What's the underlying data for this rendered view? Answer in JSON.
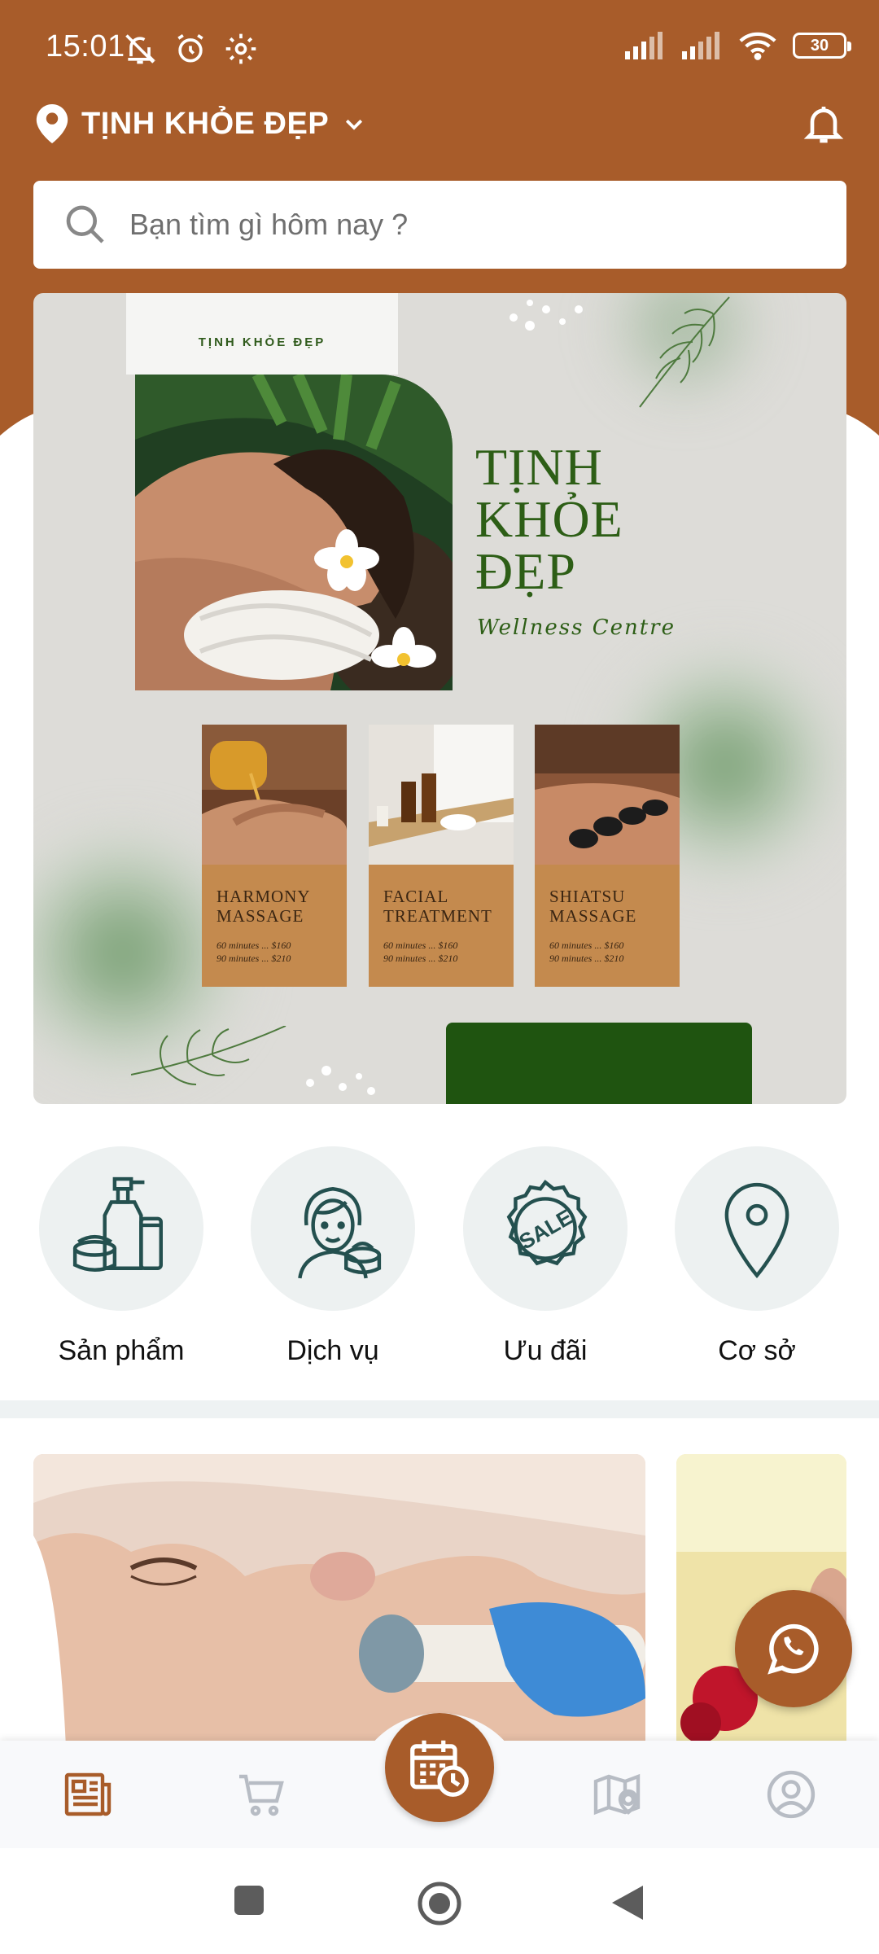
{
  "status_bar": {
    "time": "15:01",
    "battery": "30",
    "left_icons": [
      "notifications-off-icon",
      "alarm-icon",
      "settings-icon"
    ],
    "right_icons": [
      "signal-1-icon",
      "signal-2-icon",
      "wifi-icon",
      "battery-icon"
    ]
  },
  "header": {
    "location_name": "TỊNH KHỎE ĐẸP",
    "location_icon": "map-pin-icon",
    "dropdown_icon": "chevron-down-icon",
    "bell_icon": "bell-icon",
    "bg_color": "#a85c2a"
  },
  "search": {
    "placeholder": "Bạn tìm gì hôm nay ?"
  },
  "banner": {
    "tag": "TỊNH KHỎE ĐẸP",
    "title_lines": [
      "TỊNH",
      "KHỎE",
      "ĐẸP"
    ],
    "subtitle": "Wellness Centre",
    "cards": [
      {
        "title_1": "HARMONY",
        "title_2": "MASSAGE",
        "price_1": "60 minutes ... $160",
        "price_2": "90 minutes ... $210"
      },
      {
        "title_1": "FACIAL",
        "title_2": "TREATMENT",
        "price_1": "60 minutes ... $160",
        "price_2": "90 minutes ... $210"
      },
      {
        "title_1": "SHIATSU",
        "title_2": "MASSAGE",
        "price_1": "60 minutes ... $160",
        "price_2": "90 minutes ... $210"
      }
    ]
  },
  "categories": [
    {
      "label": "Sản phẩm",
      "icon": "cosmetics-icon"
    },
    {
      "label": "Dịch vụ",
      "icon": "facial-service-icon"
    },
    {
      "label": "Ưu đãi",
      "icon": "sale-badge-icon"
    },
    {
      "label": "Cơ sở",
      "icon": "location-pin-icon"
    }
  ],
  "fab": {
    "icon": "whatsapp-icon"
  },
  "bottom_nav": {
    "items": [
      "news-icon",
      "cart-icon",
      "calendar-booking-icon",
      "map-icon",
      "profile-icon"
    ],
    "active_color": "#a85c2a",
    "inactive_color": "#b7bcc4"
  },
  "system_nav": [
    "recents-icon",
    "home-icon",
    "back-icon"
  ]
}
